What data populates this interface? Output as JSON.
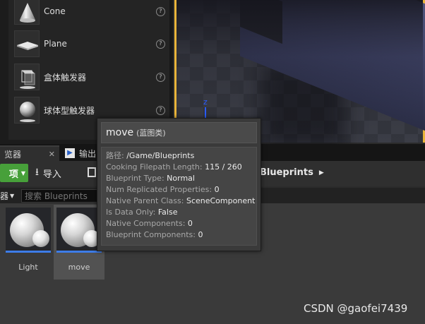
{
  "place_panel": {
    "items": [
      {
        "label": "Cone",
        "icon": "cone-icon"
      },
      {
        "label": "Plane",
        "icon": "plane-icon"
      },
      {
        "label": "盒体触发器",
        "icon": "box-trigger-icon"
      },
      {
        "label": "球体型触发器",
        "icon": "sphere-trigger-icon"
      }
    ],
    "help_glyph": "?"
  },
  "viewport": {
    "axis_label": "z"
  },
  "tabs": [
    {
      "label": "览器",
      "close": "✕"
    },
    {
      "label": "输出",
      "icon_glyph": "▶"
    }
  ],
  "toolbar": {
    "add_label": "项",
    "import_label": "导入",
    "breadcrumb": "Blueprints",
    "breadcrumb_arrow": "▶"
  },
  "filter": {
    "label": "器",
    "search_placeholder": "搜索 Blueprints"
  },
  "assets": [
    {
      "label": "Light",
      "selected": false
    },
    {
      "label": "move",
      "selected": true
    }
  ],
  "tooltip": {
    "name": "move",
    "kind": "(蓝图类)",
    "rows": [
      {
        "key": "路径:",
        "value": "/Game/Blueprints"
      },
      {
        "key": "Cooking Filepath Length:",
        "value": "115 / 260"
      },
      {
        "key": "Blueprint Type:",
        "value": "Normal"
      },
      {
        "key": "Num Replicated Properties:",
        "value": "0"
      },
      {
        "key": "Native Parent Class:",
        "value": "SceneComponent"
      },
      {
        "key": "Is Data Only:",
        "value": "False"
      },
      {
        "key": "Native Components:",
        "value": "0"
      },
      {
        "key": "Blueprint Components:",
        "value": "0"
      }
    ]
  },
  "watermark": "CSDN @gaofei7439",
  "colors": {
    "accent_green": "#47a03a",
    "selection_yellow": "#e9b43a",
    "thumb_underline": "#3d7ce8"
  }
}
